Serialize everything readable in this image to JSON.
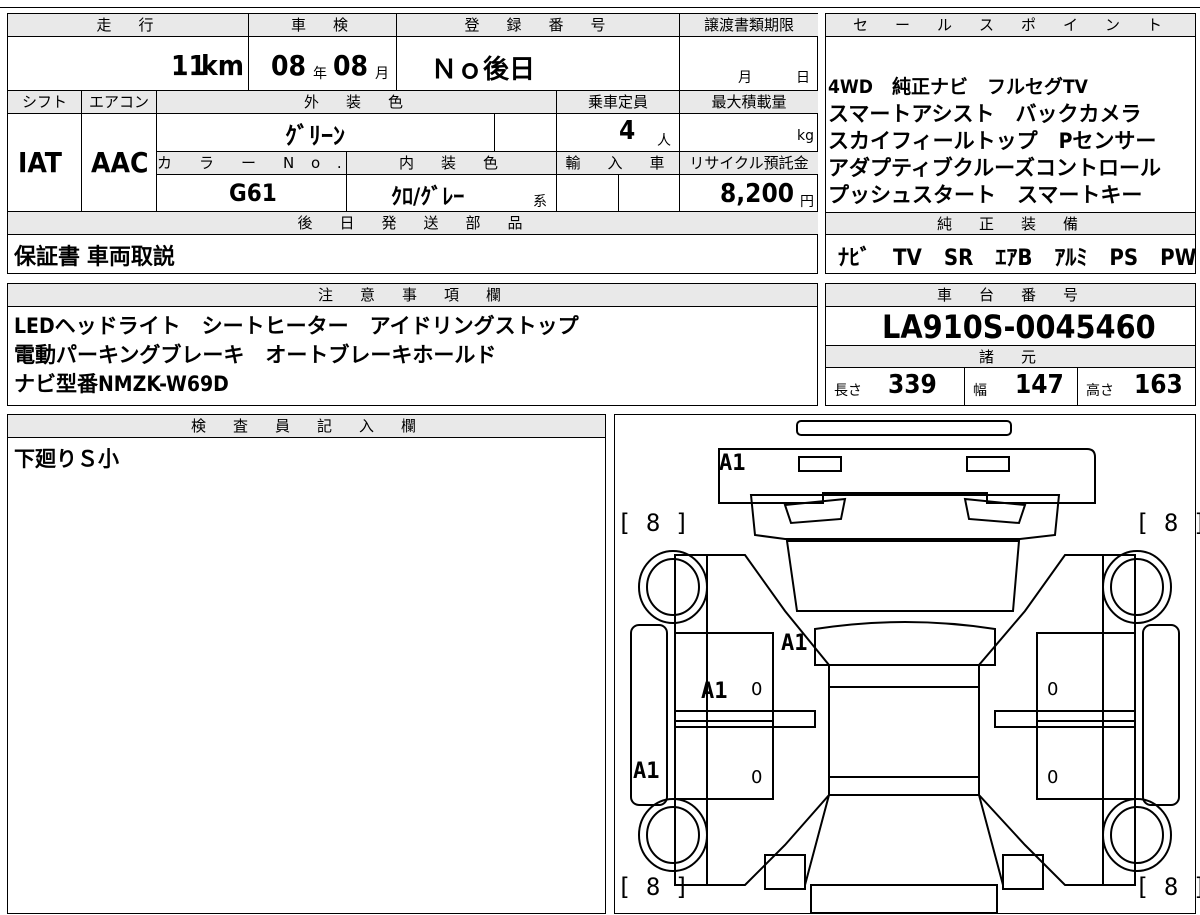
{
  "top": {
    "h_mileage": "走　行",
    "h_inspection": "車　検",
    "h_registration": "登　録　番　号",
    "h_transfer": "譲渡書類期限",
    "mileage_value": "11",
    "mileage_unit": "km",
    "insp_year": "08",
    "insp_year_unit": "年",
    "insp_month": "08",
    "insp_month_unit": "月",
    "registration": "Ｎｏ後日",
    "transfer_month": "月",
    "transfer_day": "日",
    "h_shift": "シフト",
    "h_aircon": "エアコン",
    "h_exterior": "外　装　色",
    "h_capacity": "乗車定員",
    "h_maxload": "最大積載量",
    "shift": "IAT",
    "aircon": "AAC",
    "exterior_color": "ｸﾞﾘｰﾝ",
    "capacity": "4",
    "capacity_unit": "人",
    "maxload_unit": "kg",
    "h_colorno": "カ　ラ　ー　N o .",
    "h_interior": "内　装　色",
    "h_import": "輸　入　車",
    "h_recycle": "リサイクル預託金",
    "color_no": "G61",
    "interior_color": "ｸﾛ/ｸﾞﾚｰ",
    "interior_suffix": "系",
    "recycle_value": "8,200",
    "recycle_unit": "円",
    "h_later_parts": "後　日　発　送　部　品",
    "later_parts": "保証書 車両取説"
  },
  "sales": {
    "header": "セ　ー　ル　ス　ポ　イ　ン　ト",
    "lines": [
      "4WD　純正ナビ　フルセグTV",
      "スマートアシスト　バックカメラ",
      "スカイフィールトップ　Pセンサー",
      "アダプティブクルーズコントロール",
      "プッシュスタート　スマートキー"
    ],
    "equip_header": "純　正　装　備",
    "equip": "ﾅﾋﾞ　TV　SR　ｴｱB　ｱﾙﾐ　PS　PW"
  },
  "notes": {
    "header": "注　意　事　項　欄",
    "lines": [
      "LEDヘッドライト　シートヒーター　アイドリングストップ",
      "電動パーキングブレーキ　オートブレーキホールド",
      "ナビ型番NMZK-W69D"
    ]
  },
  "chassis": {
    "header": "車　台　番　号",
    "number": "LA910S-0045460",
    "spec_header": "諸　元",
    "len_label": "長さ",
    "len": "339",
    "wid_label": "幅",
    "wid": "147",
    "hei_label": "高さ",
    "hei": "163"
  },
  "inspector": {
    "header": "検　査　員　記　入　欄",
    "text": "下廻りＳ小"
  },
  "diagram": {
    "a1_front": "A1",
    "a1_windshield": "A1",
    "a1_left_door": "A1",
    "a1_left_rear": "A1",
    "tyre_fl": "[ 8 ]",
    "tyre_fr": "[ 8 ]",
    "tyre_rl": "[ 8 ]",
    "tyre_rr": "[ 8 ]",
    "zero_1": "0",
    "zero_2": "0",
    "zero_3": "0",
    "zero_4": "0"
  }
}
